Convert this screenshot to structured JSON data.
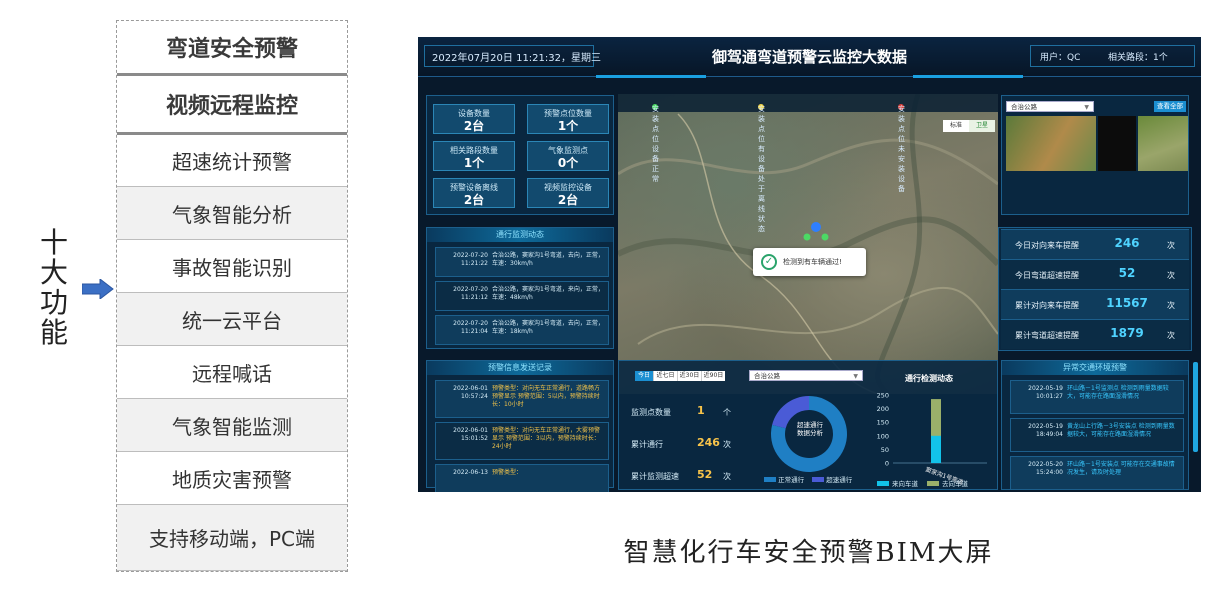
{
  "left": {
    "vertical_title": [
      "十",
      "大",
      "功",
      "能"
    ],
    "arrow_icon": "right-arrow",
    "features": [
      {
        "label": "弯道安全预警",
        "bold": true
      },
      {
        "label": "视频远程监控",
        "bold": true
      },
      {
        "label": "超速统计预警",
        "bold": false
      },
      {
        "label": "气象智能分析",
        "bold": false
      },
      {
        "label": "事故智能识别",
        "bold": false
      },
      {
        "label": "统一云平台",
        "bold": false
      },
      {
        "label": "远程喊话",
        "bold": false
      },
      {
        "label": "气象智能监测",
        "bold": false
      },
      {
        "label": "地质灾害预警",
        "bold": false
      },
      {
        "label": "支持移动端，PC端",
        "bold": false
      }
    ]
  },
  "caption": "智慧化行车安全预警BIM大屏",
  "dashboard": {
    "date": "2022年07月20日 11:21:32，星期三",
    "title": "御驾通弯道预警云监控大数据",
    "user": "用户：QC",
    "route": "相关路段：1个",
    "stats": [
      {
        "label": "设备数量",
        "value": "2台"
      },
      {
        "label": "预警点位数量",
        "value": "1个"
      },
      {
        "label": "相关路段数量",
        "value": "1个"
      },
      {
        "label": "气象监测点",
        "value": "0个"
      },
      {
        "label": "预警设备离线",
        "value": "2台"
      },
      {
        "label": "视频监控设备",
        "value": "2台"
      }
    ],
    "traffic_panel": {
      "title": "通行监测动态",
      "records": [
        {
          "date": "2022-07-20",
          "time": "11:21:22",
          "text": "合治公路，窦家沟1号弯道，去向，正常，车速：30km/h"
        },
        {
          "date": "2022-07-20",
          "time": "11:21:12",
          "text": "合治公路，窦家沟1号弯道，来向，正常，车速：48km/h"
        },
        {
          "date": "2022-07-20",
          "time": "11:21:04",
          "text": "合治公路，窦家沟1号弯道，去向，正常，车速：18km/h"
        }
      ]
    },
    "warning_panel": {
      "title": "预警信息发送记录",
      "records": [
        {
          "date": "2022-06-01",
          "time": "10:57:24",
          "text": "预警类型：对向无车正常通行，道路畅方预警显示 预警范围：5以内，预警持续时长：10小时"
        },
        {
          "date": "2022-06-01",
          "time": "15:01:52",
          "text": "预警类型：对向无车正常通行，大雾预警显示 预警范围：3以内，预警持续时长：24小时"
        },
        {
          "date": "2022-06-13",
          "time": "",
          "text": "预警类型："
        }
      ]
    },
    "map_legend": [
      {
        "label": "安装点位设备正常",
        "color": "#4cd964"
      },
      {
        "label": "安装点位有设备处于离线状态",
        "color": "#f7d94a"
      },
      {
        "label": "安装点位未安装设备",
        "color": "#e0413a"
      }
    ],
    "map_toggle": [
      "标准",
      "卫星"
    ],
    "map_toast": "检测到有车辆通过!",
    "video_panel": {
      "select": "合治公路",
      "button": "查看全部"
    },
    "right_stats": [
      {
        "label": "今日对向来车提醒",
        "value": "246",
        "unit": "次"
      },
      {
        "label": "今日弯道超速提醒",
        "value": "52",
        "unit": "次"
      },
      {
        "label": "累计对向来车提醒",
        "value": "11567",
        "unit": "次"
      },
      {
        "label": "累计弯道超速提醒",
        "value": "1879",
        "unit": "次"
      }
    ],
    "bottom": {
      "tabs": [
        "今日",
        "近七日",
        "近30日",
        "近90日"
      ],
      "select": "合治公路",
      "stats": [
        {
          "label": "监测点数量",
          "value": "1",
          "unit": "个"
        },
        {
          "label": "累计通行",
          "value": "246",
          "unit": "次"
        },
        {
          "label": "累计监测超速",
          "value": "52",
          "unit": "次"
        }
      ],
      "donut_label": "超速通行\n数据分析",
      "donut_legend": [
        "正常通行",
        "超速通行"
      ],
      "chart_title": "通行检测动态",
      "chart_xlabel": "窦家沟1号弯道",
      "chart_legend": [
        "来向车道",
        "去向车道"
      ]
    },
    "env_panel": {
      "title": "异常交通环境预警",
      "records": [
        {
          "date": "2022-05-19",
          "time": "10:01:27",
          "text": "环山路－1号监测点 检测到雨量数据较大，可能存在路面湿滑情况"
        },
        {
          "date": "2022-05-19",
          "time": "18:49:04",
          "text": "黄龙山上行路－3号安装点 检测到雨量数据较大，可能存在路面湿滑情况"
        },
        {
          "date": "2022-05-20",
          "time": "15:24:00",
          "text": "环山路－1号安装点 可能存在交通事故情况发生，请及时处理"
        }
      ]
    }
  },
  "chart_data": {
    "type": "bar",
    "title": "通行检测动态",
    "categories": [
      "窦家沟1号弯道"
    ],
    "ylim": [
      0,
      250
    ],
    "yticks": [
      0,
      50,
      100,
      150,
      200,
      250
    ],
    "series": [
      {
        "name": "来向车道",
        "values": [
          100
        ],
        "color": "#12c2e9"
      },
      {
        "name": "去向车道",
        "values": [
          235
        ],
        "color": "#9ab06a"
      }
    ],
    "donut": {
      "type": "pie",
      "slices": [
        {
          "name": "正常通行",
          "value": 194,
          "color": "#1f7fc4"
        },
        {
          "name": "超速通行",
          "value": 52,
          "color": "#4a5bd6"
        }
      ]
    }
  }
}
